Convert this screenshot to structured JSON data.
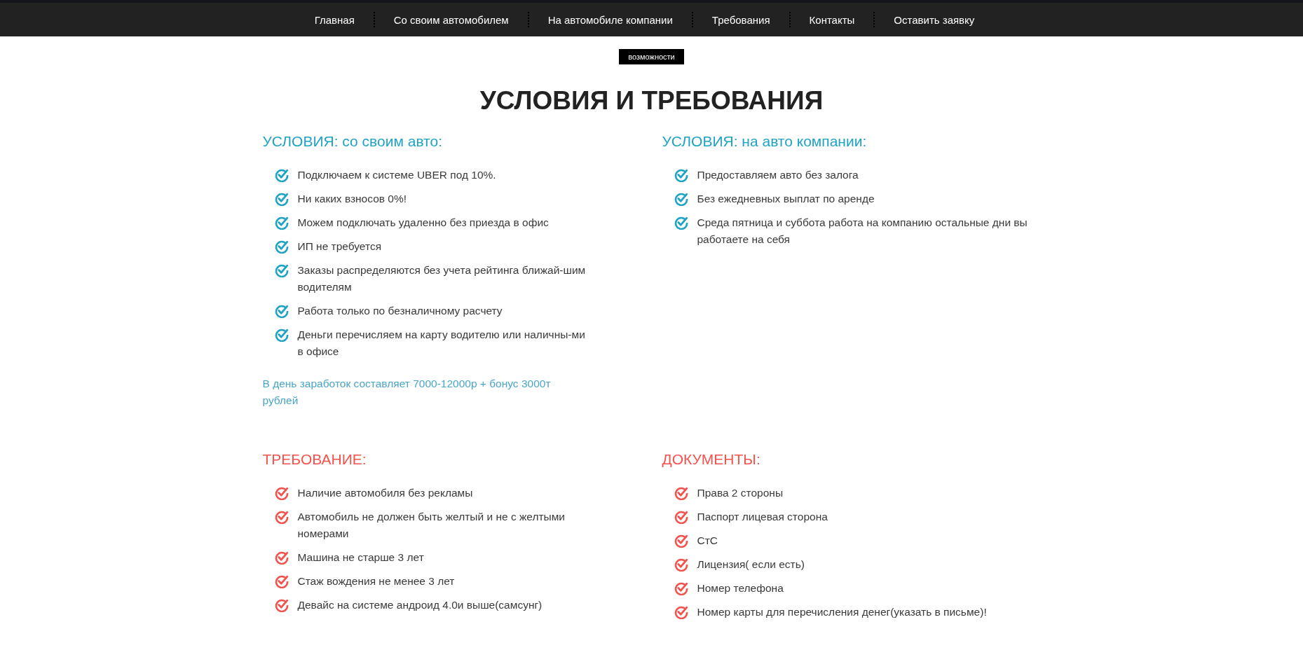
{
  "nav": {
    "items": [
      {
        "label": "Главная"
      },
      {
        "label": "Со своим автомобилем"
      },
      {
        "label": "На автомобиле компании"
      },
      {
        "label": "Требования"
      },
      {
        "label": "Контакты"
      },
      {
        "label": "Оставить заявку"
      }
    ]
  },
  "badge": "возможности",
  "title": "УСЛОВИЯ И ТРЕБОВАНИЯ",
  "sections": [
    {
      "heading": "УСЛОВИЯ: со своим авто:",
      "color": "#1fa3c4",
      "items": [
        "Подключаем к системе UBER под 10%.",
        "Ни каких взносов 0%!",
        "Можем подключать удаленно без приезда в офис",
        "ИП не требуется",
        "Заказы распределяются без учета рейтинга ближай-шим водителям",
        "Работа только по безналичному расчету",
        "Деньги перечисляем на карту водителю или наличны-ми в офисе"
      ],
      "note": "В день заработок составляет 7000-12000р + бонус 3000т рублей"
    },
    {
      "heading": "УСЛОВИЯ: на авто компании:",
      "color": "#1fa3c4",
      "items": [
        "Предоставляем авто без залога",
        "Без ежедневных выплат по аренде",
        "Среда пятница и суббота работа на компанию остальные дни вы работаете на себя"
      ]
    },
    {
      "heading": "ТРЕБОВАНИЕ:",
      "color": "#f4524d",
      "items": [
        "Наличие автомобиля без рекламы",
        "Автомобиль не должен быть желтый и не с желтыми номерами",
        "Машина не старше 3 лет",
        "Стаж вождения не менее 3 лет",
        "Девайс на системе андроид 4.0и выше(самсунг)"
      ]
    },
    {
      "heading": "ДОКУМЕНТЫ:",
      "color": "#f4524d",
      "items": [
        "Права 2 стороны",
        "Паспорт лицевая сторона",
        "СтС",
        "Лицензия( если есть)",
        "Номер телефона",
        "Номер карты для перечисления денег(указать в письме)!"
      ]
    }
  ]
}
